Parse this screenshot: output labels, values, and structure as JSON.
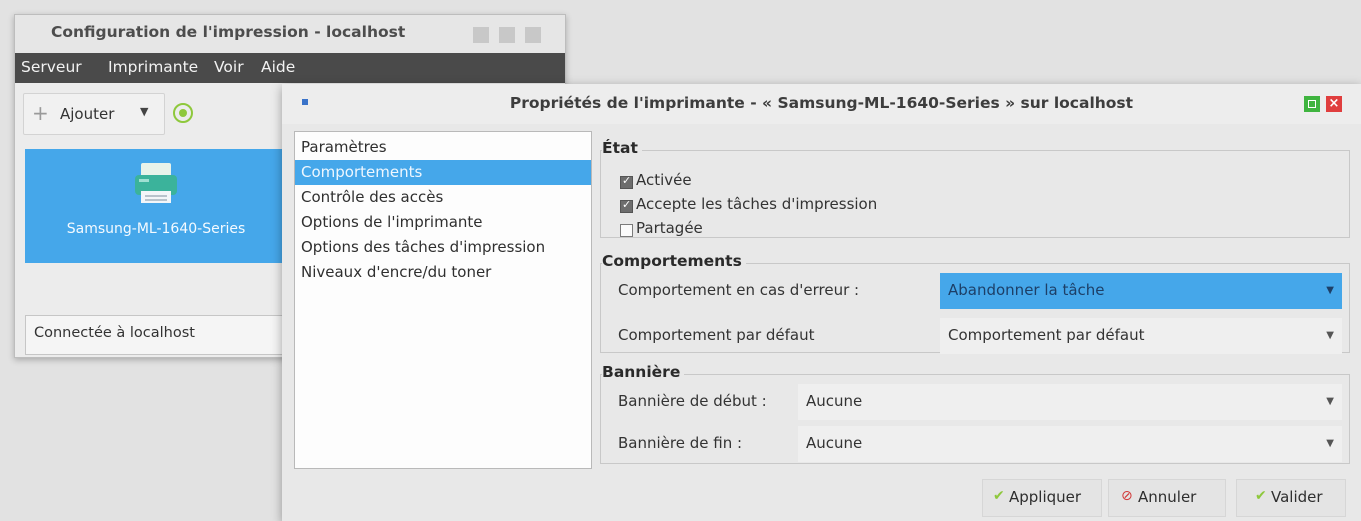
{
  "back_window": {
    "title": "Configuration de l'impression - localhost",
    "menu": [
      "Serveur",
      "Imprimante",
      "Voir",
      "Aide"
    ],
    "add_button": "Ajouter",
    "printer_name": "Samsung-ML-1640-Series",
    "status": "Connectée à localhost"
  },
  "dialog": {
    "title": "Propriétés de l'imprimante - « Samsung-ML-1640-Series » sur localhost",
    "close_glyph": "×",
    "nav": [
      "Paramètres",
      "Comportements",
      "Contrôle des accès",
      "Options de l'imprimante",
      "Options des tâches d'impression",
      "Niveaux d'encre/du toner"
    ],
    "selected_nav": "Comportements",
    "etat": {
      "title": "État",
      "activee": "Activée",
      "accepte": "Accepte les tâches d'impression",
      "partagee": "Partagée",
      "activee_checked": true,
      "accepte_checked": true,
      "partagee_checked": false
    },
    "comportements": {
      "title": "Comportements",
      "error_label": "Comportement en cas d'erreur :",
      "error_value": "Abandonner la tâche",
      "default_label": "Comportement par défaut",
      "default_value": "Comportement par défaut"
    },
    "banniere": {
      "title": "Bannière",
      "start_label": "Bannière de début :",
      "start_value": "Aucune",
      "end_label": "Bannière de fin :",
      "end_value": "Aucune"
    },
    "buttons": {
      "apply": "Appliquer",
      "cancel": "Annuler",
      "ok": "Valider"
    }
  },
  "colors": {
    "selection": "#45a7ea",
    "menubar": "#4a4a4a",
    "check_green": "#8ec83c",
    "cancel_red": "#d23a3a",
    "close_red": "#e03e3e",
    "maximize_green": "#3fb43f"
  }
}
